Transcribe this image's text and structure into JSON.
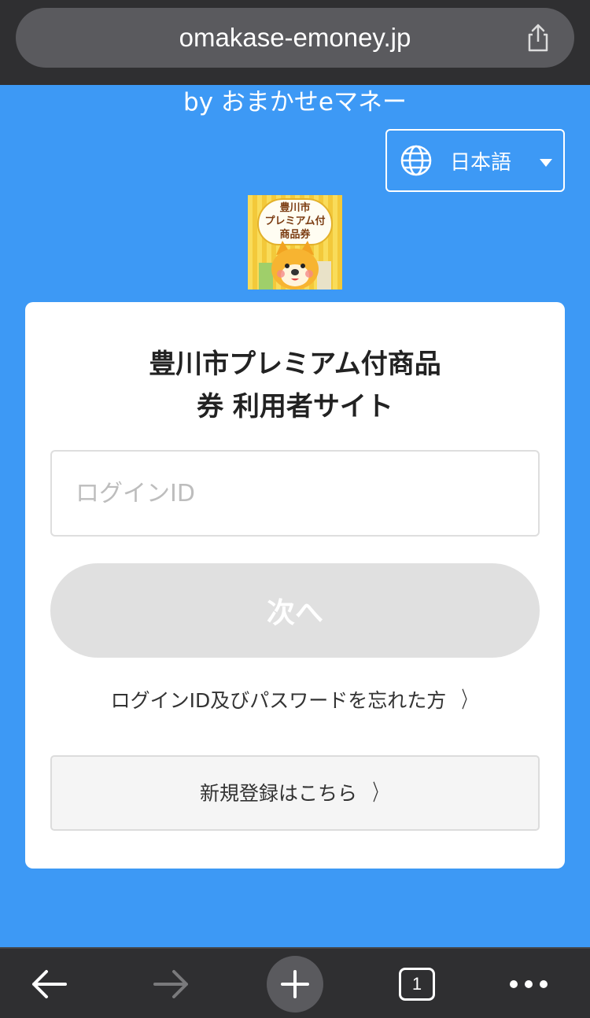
{
  "browser": {
    "url": "omakase-emoney.jp",
    "tab_count": "1"
  },
  "header": {
    "byline": "by おまかせeマネー",
    "language": "日本語"
  },
  "logo": {
    "lines": [
      "豊川市",
      "プレミアム付",
      "商品券"
    ]
  },
  "card": {
    "title_line1": "豊川市プレミアム付商品",
    "title_line2": "券 利用者サイト",
    "login_placeholder": "ログインID",
    "next_label": "次へ",
    "forgot_label": "ログインID及びパスワードを忘れた方",
    "register_label": "新規登録はこちら"
  },
  "colors": {
    "background": "#3d99f5",
    "browser_chrome": "#2f2f31",
    "button_disabled": "#e0e0e0"
  },
  "icons": {
    "share": "share-icon",
    "globe": "globe-icon",
    "back": "back-arrow-icon",
    "forward": "forward-arrow-icon",
    "new_tab": "plus-icon",
    "more": "more-icon"
  }
}
